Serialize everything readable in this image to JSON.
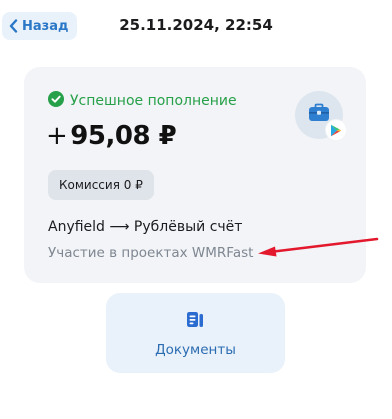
{
  "header": {
    "back_label": "Назад",
    "datetime": "25.11.2024, 22:54"
  },
  "transaction": {
    "status": "Успешное пополнение",
    "amount_sign": "+",
    "amount": "95,08 ₽",
    "commission": "Комиссия 0 ₽",
    "route": "Anyfield ⟶ Рублёвый счёт",
    "purpose": "Участие в проектах WMRFast"
  },
  "actions": {
    "documents_label": "Документы"
  },
  "icons": {
    "back": "chevron-left-icon",
    "status": "check-circle-icon",
    "merchant": "briefcase-icon",
    "merchant_badge": "play-store-badge-icon",
    "documents": "documents-icon",
    "annotation": "red-arrow-icon"
  },
  "colors": {
    "accent": "#2b77c7",
    "success": "#27a04a",
    "annotation": "#e3182d",
    "card_bg": "#f2f4f7",
    "button_bg": "#e9f2fb"
  }
}
